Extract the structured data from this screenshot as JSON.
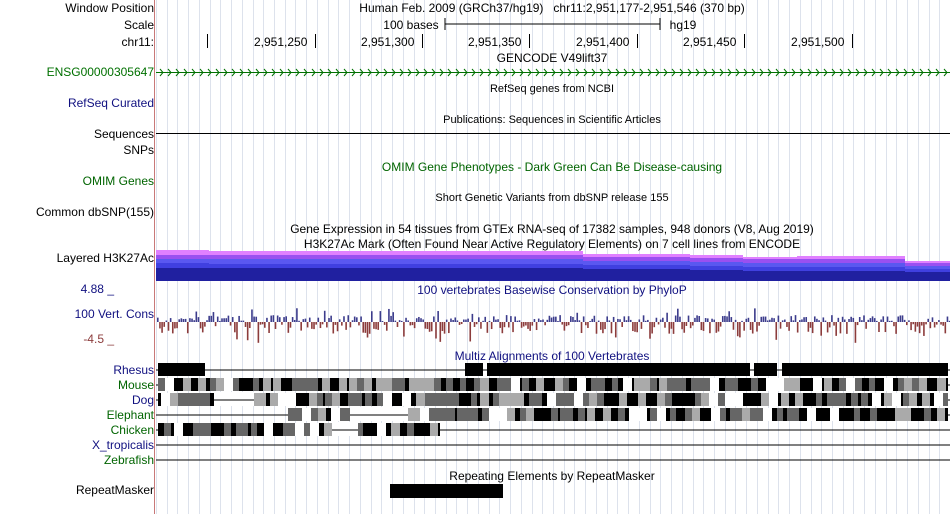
{
  "header": {
    "window_position_label": "Window Position",
    "scale_label": "Scale",
    "chrom_label": "chr11:",
    "assembly": "Human Feb. 2009 (GRCh37/hg19)",
    "position": "chr11:2,951,177-2,951,546 (370 bp)",
    "scale_text": "100 bases",
    "scale_db": "hg19",
    "ticks": [
      "2,951,250",
      "2,951,300",
      "2,951,350",
      "2,951,400",
      "2,951,450",
      "2,951,500"
    ]
  },
  "tracks": {
    "gencode": {
      "title": "GENCODE V49lift37",
      "label": "ENSG00000305647"
    },
    "refseq": {
      "title": "RefSeq genes from NCBI",
      "label": "RefSeq Curated"
    },
    "publications": {
      "title": "Publications: Sequences in Scientific Articles",
      "label": "Sequences"
    },
    "snps": {
      "label": "SNPs"
    },
    "omim": {
      "title": "OMIM Gene Phenotypes - Dark Green Can Be Disease-causing",
      "label": "OMIM Genes"
    },
    "dbsnp": {
      "title": "Short Genetic Variants from dbSNP release 155",
      "label": "Common dbSNP(155)"
    },
    "gtex": {
      "title": "Gene Expression in 54 tissues from GTEx RNA-seq of 17382 samples, 948 donors (V8, Aug 2019)"
    },
    "h3k27ac": {
      "title": "H3K27Ac Mark (Often Found Near Active Regulatory Elements) on 7 cell lines from ENCODE",
      "label": "Layered H3K27Ac"
    },
    "cons": {
      "title": "100 vertebrates Basewise Conservation by PhyloP",
      "label": "100 Vert. Cons",
      "max": "4.88 _",
      "min": "-4.5 _"
    },
    "multiz": {
      "title": "Multiz Alignments of 100 Vertebrates",
      "species": [
        "Rhesus",
        "Mouse",
        "Dog",
        "Elephant",
        "Chicken",
        "X_tropicalis",
        "Zebrafish"
      ]
    },
    "repeatmasker": {
      "title": "Repeating Elements by RepeatMasker",
      "label": "RepeatMasker"
    }
  },
  "colors": {
    "gencode": "#007000",
    "refseq": "#101080",
    "omim": "#006400",
    "cons_pos": "#3c3c8c",
    "cons_neg": "#8c3c3c",
    "h3k27ac_top": "#e080ff",
    "h3k27ac_mid": "#4040e0",
    "h3k27ac_base": "#2020a0"
  }
}
